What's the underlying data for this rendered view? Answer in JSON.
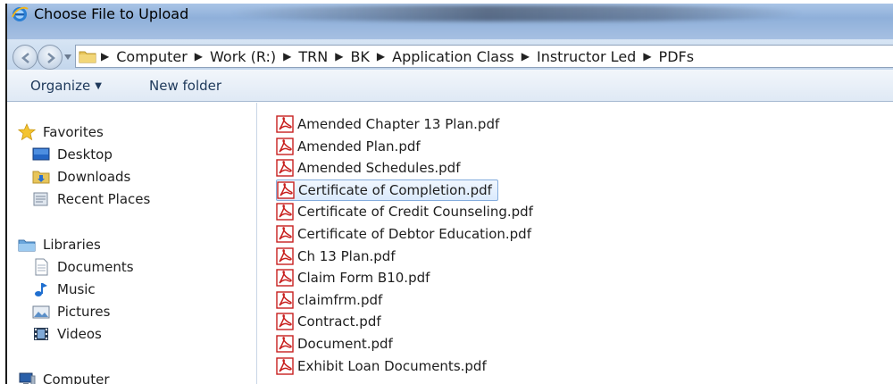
{
  "window": {
    "title": "Choose File to Upload"
  },
  "address": {
    "crumbs": [
      "Computer",
      "Work (R:)",
      "TRN",
      "BK",
      "Application Class",
      "Instructor Led",
      "PDFs"
    ]
  },
  "toolbar": {
    "organize_label": "Organize",
    "new_folder_label": "New folder"
  },
  "nav": {
    "favorites": {
      "label": "Favorites",
      "items": [
        "Desktop",
        "Downloads",
        "Recent Places"
      ]
    },
    "libraries": {
      "label": "Libraries",
      "items": [
        "Documents",
        "Music",
        "Pictures",
        "Videos"
      ]
    },
    "computer": {
      "label": "Computer"
    }
  },
  "files": [
    "Amended Chapter 13 Plan.pdf",
    "Amended Plan.pdf",
    "Amended Schedules.pdf",
    "Certificate of Completion.pdf",
    "Certificate of Credit Counseling.pdf",
    "Certificate of Debtor Education.pdf",
    "Ch 13 Plan.pdf",
    "Claim Form B10.pdf",
    "claimfrm.pdf",
    "Contract.pdf",
    "Document.pdf",
    "Exhibit Loan Documents.pdf"
  ],
  "selected_file": "Certificate of Completion.pdf",
  "colors": {
    "accent": "#1e395b",
    "selection_border": "#84acdd",
    "pdf_red": "#c8201e"
  }
}
